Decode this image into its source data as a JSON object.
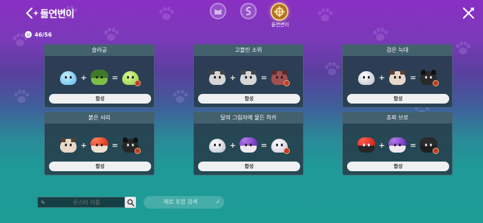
{
  "header": {
    "title": "돌연변이"
  },
  "tabs": [
    {
      "name": "tab-1"
    },
    {
      "name": "tab-2"
    },
    {
      "name": "tab-mutation",
      "label": "돌연변이"
    }
  ],
  "counter": {
    "value": "46/56"
  },
  "recipes": [
    {
      "title": "슬라공",
      "button": "합성"
    },
    {
      "title": "고블린 소위",
      "button": "합성"
    },
    {
      "title": "검은 늑대",
      "button": "합성"
    },
    {
      "title": "붉은 서리",
      "button": "합성"
    },
    {
      "title": "달의 그림자에 물든 하카",
      "button": "합성"
    },
    {
      "title": "쵸파 브로",
      "button": "합성"
    }
  ],
  "operators": {
    "plus": "+",
    "equals": "="
  },
  "search": {
    "placeholder": "몬스터 이름"
  },
  "material_search": {
    "label": "재료 포함 검색"
  },
  "colors": {
    "bg_top": "#8a2fc4",
    "bg_bottom": "#1d9c96",
    "card_bg": "#263e4a",
    "button_bg": "#eef0f2",
    "badge": "#c0392b"
  }
}
